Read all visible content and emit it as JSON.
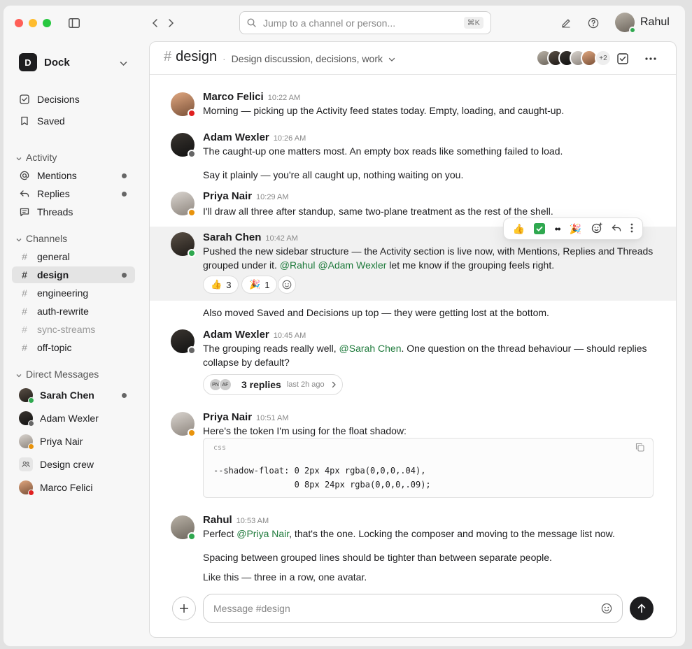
{
  "app": {
    "search_placeholder": "Jump to a channel or person...",
    "search_shortcut": "⌘K",
    "user_name": "Rahul"
  },
  "workspace": {
    "initial": "D",
    "name": "Dock"
  },
  "sidebar": {
    "top_items": [
      {
        "label": "Decisions",
        "icon": "decisions-check-icon"
      },
      {
        "label": "Saved",
        "icon": "bookmark-icon"
      }
    ],
    "activity_header": "Activity",
    "activity_items": [
      {
        "label": "Mentions",
        "icon": "at-icon",
        "unread": true
      },
      {
        "label": "Replies",
        "icon": "reply-icon",
        "unread": true
      },
      {
        "label": "Threads",
        "icon": "threads-icon",
        "unread": false
      }
    ],
    "channels_header": "Channels",
    "channels": [
      {
        "label": "general"
      },
      {
        "label": "design",
        "active": true,
        "unread": true
      },
      {
        "label": "engineering"
      },
      {
        "label": "auth-rewrite"
      },
      {
        "label": "sync-streams",
        "muted": true
      },
      {
        "label": "off-topic"
      }
    ],
    "dm_header": "Direct Messages",
    "dms": [
      {
        "label": "Sarah Chen",
        "bold": true,
        "unread": true,
        "status": "#2fa84f"
      },
      {
        "label": "Adam Wexler",
        "status": "#666666"
      },
      {
        "label": "Priya Nair",
        "status": "#e8930c"
      },
      {
        "label": "Design crew",
        "group": true
      },
      {
        "label": "Marco Felici",
        "status": "#e02020"
      }
    ]
  },
  "channel": {
    "hash": "#",
    "name": "design",
    "separator": "·",
    "description": "Design discussion, decisions, work",
    "member_overflow": "+2"
  },
  "messages": {
    "m1": {
      "name": "Marco Felici",
      "time": "10:22 AM",
      "text": "Morning — picking up the Activity feed states today. Empty, loading, and caught-up."
    },
    "m2": {
      "name": "Adam Wexler",
      "time": "10:26 AM",
      "text": "The caught-up one matters most. An empty box reads like something failed to load.",
      "text2": "Say it plainly — you're all caught up, nothing waiting on you."
    },
    "m3": {
      "name": "Priya Nair",
      "time": "10:29 AM",
      "text": "I'll draw all three after standup, same two-plane treatment as the rest of the shell."
    },
    "m4": {
      "name": "Sarah Chen",
      "time": "10:42 AM",
      "text_a": "Pushed the new sidebar structure — the Activity section is live now, with Mentions, Replies and Threads grouped under it. ",
      "mention1": "@Rahul",
      "mention2": "@Adam Wexler",
      "text_b": " let me know if the grouping feels right.",
      "reaction1_emoji": "👍",
      "reaction1_count": "3",
      "reaction2_emoji": "🎉",
      "reaction2_count": "1",
      "text2": "Also moved Saved and Decisions up top — they were getting lost at the bottom."
    },
    "m5": {
      "name": "Adam Wexler",
      "time": "10:45 AM",
      "text_a": "The grouping reads really well, ",
      "mention": "@Sarah Chen",
      "text_b": ". One question on the thread behaviour — should replies collapse by default?",
      "thread_a1": "PN",
      "thread_a2": "AF",
      "thread_label": "3 replies",
      "thread_meta": "last 2h ago"
    },
    "m6": {
      "name": "Priya Nair",
      "time": "10:51 AM",
      "text": "Here's the token I'm using for the float shadow:",
      "code_lang": "css",
      "code": "--shadow-float: 0 2px 4px rgba(0,0,0,.04),\n                0 8px 24px rgba(0,0,0,.09);"
    },
    "m7": {
      "name": "Rahul",
      "time": "10:53 AM",
      "text_a": "Perfect ",
      "mention": "@Priya Nair",
      "text_b": ", that's the one. Locking the composer and moving to the message list now.",
      "text2": "Spacing between grouped lines should be tighter than between separate people.",
      "text3": "Like this — three in a row, one avatar."
    }
  },
  "reaction_bar": [
    "👍",
    "✅",
    "👀",
    "🎉"
  ],
  "composer": {
    "placeholder": "Message #design"
  }
}
